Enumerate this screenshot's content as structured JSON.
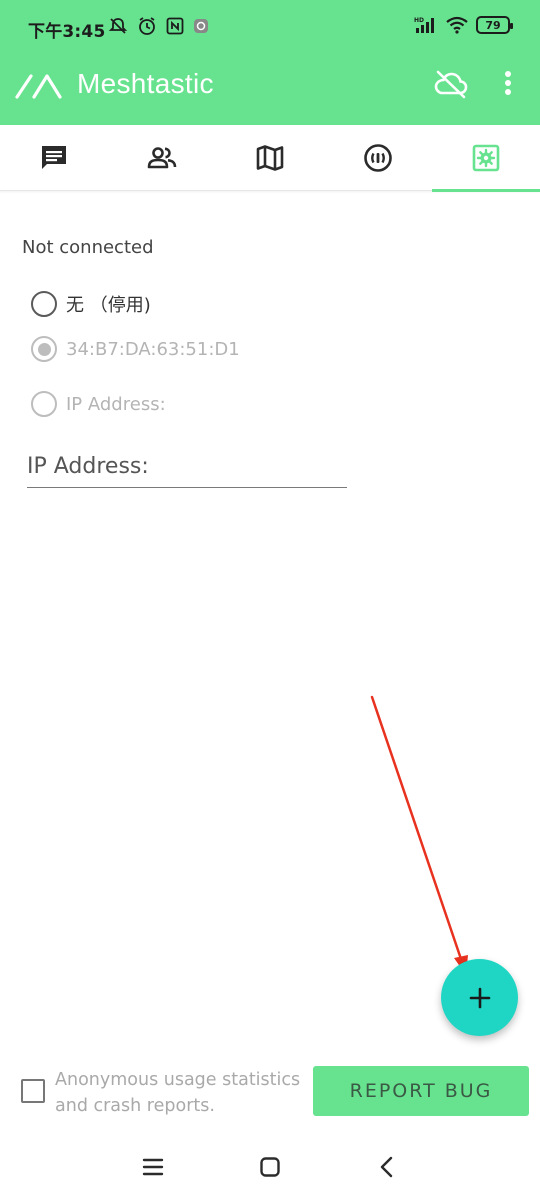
{
  "status_bar": {
    "time": "下午3:45",
    "battery": "79"
  },
  "app_bar": {
    "title": "Meshtastic"
  },
  "tabs": [
    {
      "name": "messages",
      "icon": "chat-icon"
    },
    {
      "name": "nodes",
      "icon": "users-icon"
    },
    {
      "name": "map",
      "icon": "map-icon"
    },
    {
      "name": "channel",
      "icon": "radio-signal-icon"
    },
    {
      "name": "settings",
      "icon": "gear-icon",
      "active": true
    }
  ],
  "content": {
    "connection_status": "Not connected",
    "options": [
      {
        "label": "无 （停用)",
        "selected": false,
        "disabled": false
      },
      {
        "label": "34:B7:DA:63:51:D1",
        "selected": true,
        "disabled": true
      },
      {
        "label": "IP Address:",
        "selected": false,
        "disabled": true
      }
    ],
    "ip_input": {
      "placeholder": "IP Address:",
      "value": ""
    }
  },
  "fab": {
    "icon": "plus-icon"
  },
  "footer": {
    "analytics_text": "Anonymous usage statistics and crash reports.",
    "analytics_checked": false,
    "report_bug_label": "REPORT BUG"
  },
  "colors": {
    "primary": "#67e38f",
    "fab": "#1fd6c4",
    "annotation_arrow": "#e8311f"
  }
}
